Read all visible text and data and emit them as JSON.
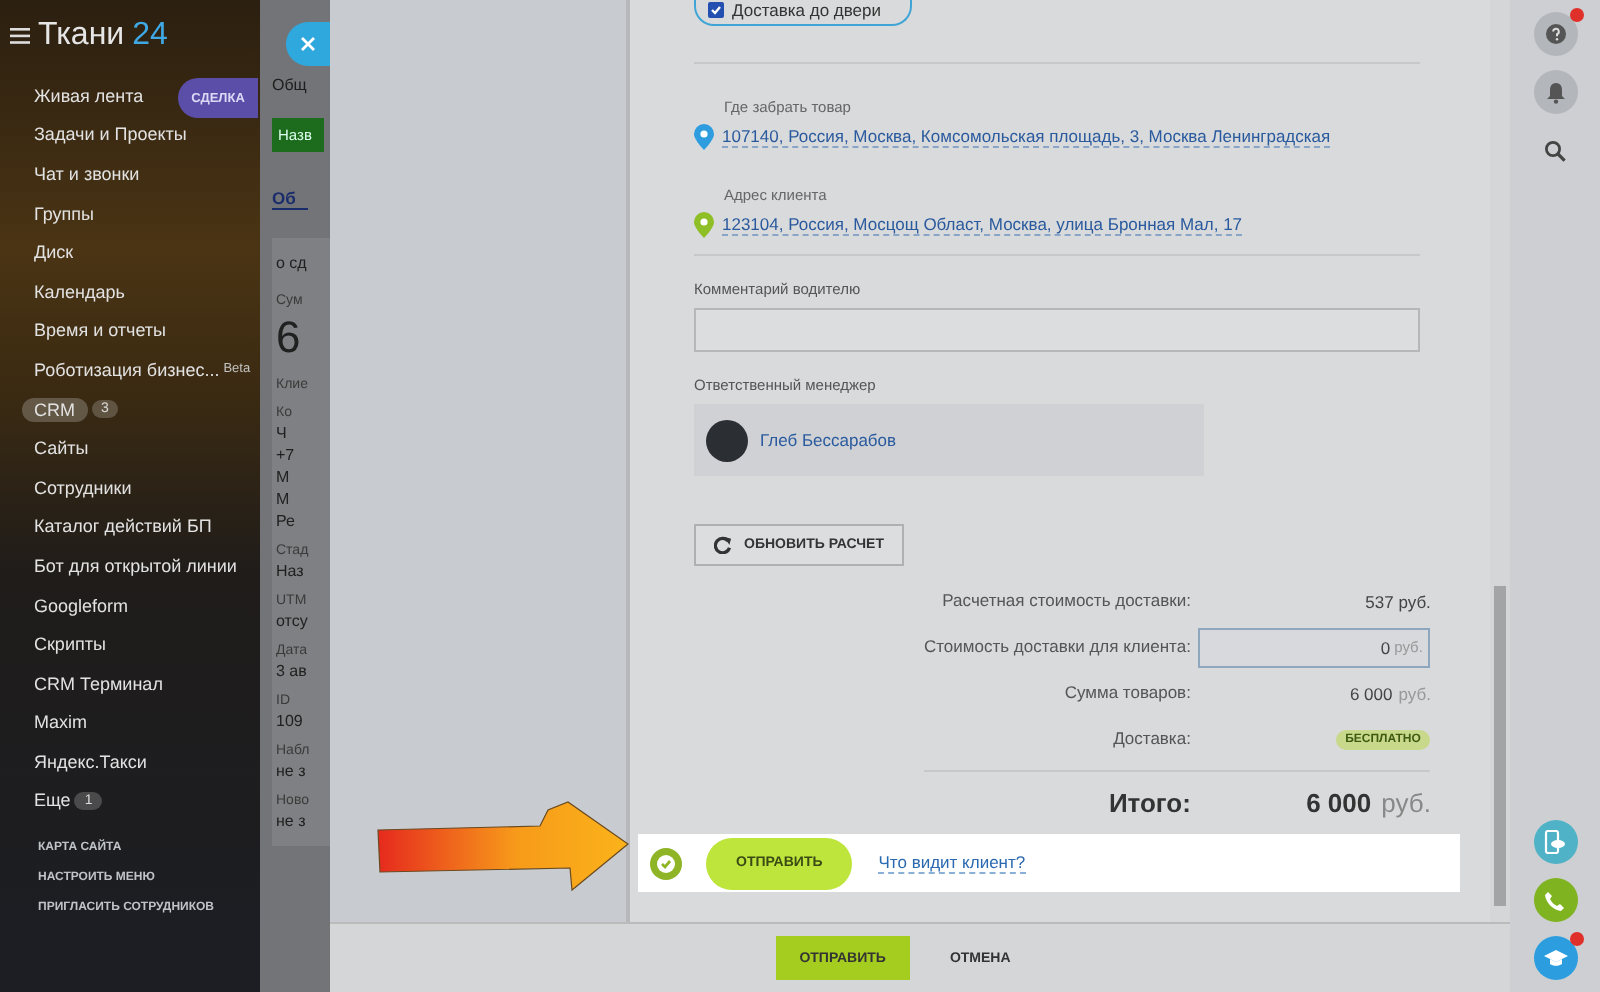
{
  "sidebar": {
    "brand": "Ткани",
    "brand_number": "24",
    "items": [
      {
        "label": "Живая лента",
        "selected": false
      },
      {
        "label": "Задачи и Проекты",
        "selected": false
      },
      {
        "label": "Чат и звонки",
        "selected": false
      },
      {
        "label": "Группы",
        "selected": false
      },
      {
        "label": "Диск",
        "selected": false
      },
      {
        "label": "Календарь",
        "selected": false
      },
      {
        "label": "Время и отчеты",
        "selected": false
      },
      {
        "label": "Роботизация бизнес...",
        "selected": false,
        "tag": "Beta"
      },
      {
        "label": "CRM",
        "selected": true,
        "count": "3"
      },
      {
        "label": "Сайты",
        "selected": false
      },
      {
        "label": "Сотрудники",
        "selected": false
      },
      {
        "label": "Каталог действий БП",
        "selected": false
      },
      {
        "label": "Бот для открытой линии",
        "selected": false
      },
      {
        "label": "Googleform",
        "selected": false
      },
      {
        "label": "Скрипты",
        "selected": false
      },
      {
        "label": "CRM Терминал",
        "selected": false
      },
      {
        "label": "Maxim",
        "selected": false
      },
      {
        "label": "Яндекс.Такси",
        "selected": false
      },
      {
        "label": "Еще",
        "selected": false,
        "count": "1"
      }
    ],
    "footer_links": [
      "КАРТА САЙТА",
      "НАСТРОИТЬ МЕНЮ",
      "ПРИГЛАСИТЬ СОТРУДНИКОВ"
    ]
  },
  "background_page": {
    "section_label": "Общ",
    "button": "Назв",
    "active_tab": "Об",
    "fragments": [
      {
        "kind": "label",
        "text": "о сд"
      },
      {
        "kind": "small",
        "text": "Сум"
      },
      {
        "kind": "big",
        "text": "6"
      },
      {
        "kind": "small",
        "text": "Клие"
      },
      {
        "kind": "small",
        "text": "Ко"
      },
      {
        "kind": "value",
        "text": "Ч"
      },
      {
        "kind": "value",
        "text": "+7"
      },
      {
        "kind": "value",
        "text": "М"
      },
      {
        "kind": "value",
        "text": "М"
      },
      {
        "kind": "value",
        "text": "Ре"
      },
      {
        "kind": "small",
        "text": "Стад"
      },
      {
        "kind": "value",
        "text": "Наз"
      },
      {
        "kind": "small",
        "text": "UTM"
      },
      {
        "kind": "value",
        "text": "отсу"
      },
      {
        "kind": "small",
        "text": "Дата"
      },
      {
        "kind": "value",
        "text": "3 ав"
      },
      {
        "kind": "small",
        "text": "ID"
      },
      {
        "kind": "value",
        "text": "109"
      },
      {
        "kind": "small",
        "text": "Набл"
      },
      {
        "kind": "value",
        "text": "не з"
      },
      {
        "kind": "small",
        "text": "Ново"
      },
      {
        "kind": "value",
        "text": "не з"
      }
    ]
  },
  "slider": {
    "badge": "СДЕЛКА",
    "delivery_option": {
      "label": "Доставка до двери",
      "checked": true
    },
    "route": [
      {
        "label": "Где забрать товар",
        "address": "107140, Россия, Москва, Комсомольская площадь, 3, Москва Ленинградская",
        "color": "#2e9de0"
      },
      {
        "label": "Адрес клиента",
        "address": "123104, Россия, Мосцощ Област, Москва, улица Бронная Мал, 17",
        "color": "#8fbf26"
      }
    ],
    "comment": {
      "label": "Комментарий водителю"
    },
    "manager": {
      "label": "Ответственный менеджер",
      "name": "Глеб Бессарабов"
    },
    "recalc_button": "ОБНОВИТЬ РАСЧЕТ",
    "summary": [
      {
        "kind": "text",
        "label": "Расчетная стоимость доставки:",
        "value": "537 руб."
      },
      {
        "kind": "input",
        "label": "Стоимость доставки для клиента:",
        "value": "0",
        "unit": "руб."
      },
      {
        "kind": "amount",
        "label": "Сумма товаров:",
        "value": "6 000",
        "unit": "руб."
      },
      {
        "kind": "badge",
        "label": "Доставка:",
        "value": "БЕСПЛАТНО"
      }
    ],
    "total": {
      "label": "Итого:",
      "value": "6 000",
      "unit": "руб."
    },
    "send_bar": {
      "button": "ОТПРАВИТЬ",
      "link": "Что видит клиент?"
    },
    "footer_buttons": [
      {
        "label": "ОТПРАВИТЬ",
        "kind": "primary"
      },
      {
        "label": "ОТМЕНА",
        "kind": "plain"
      }
    ]
  }
}
